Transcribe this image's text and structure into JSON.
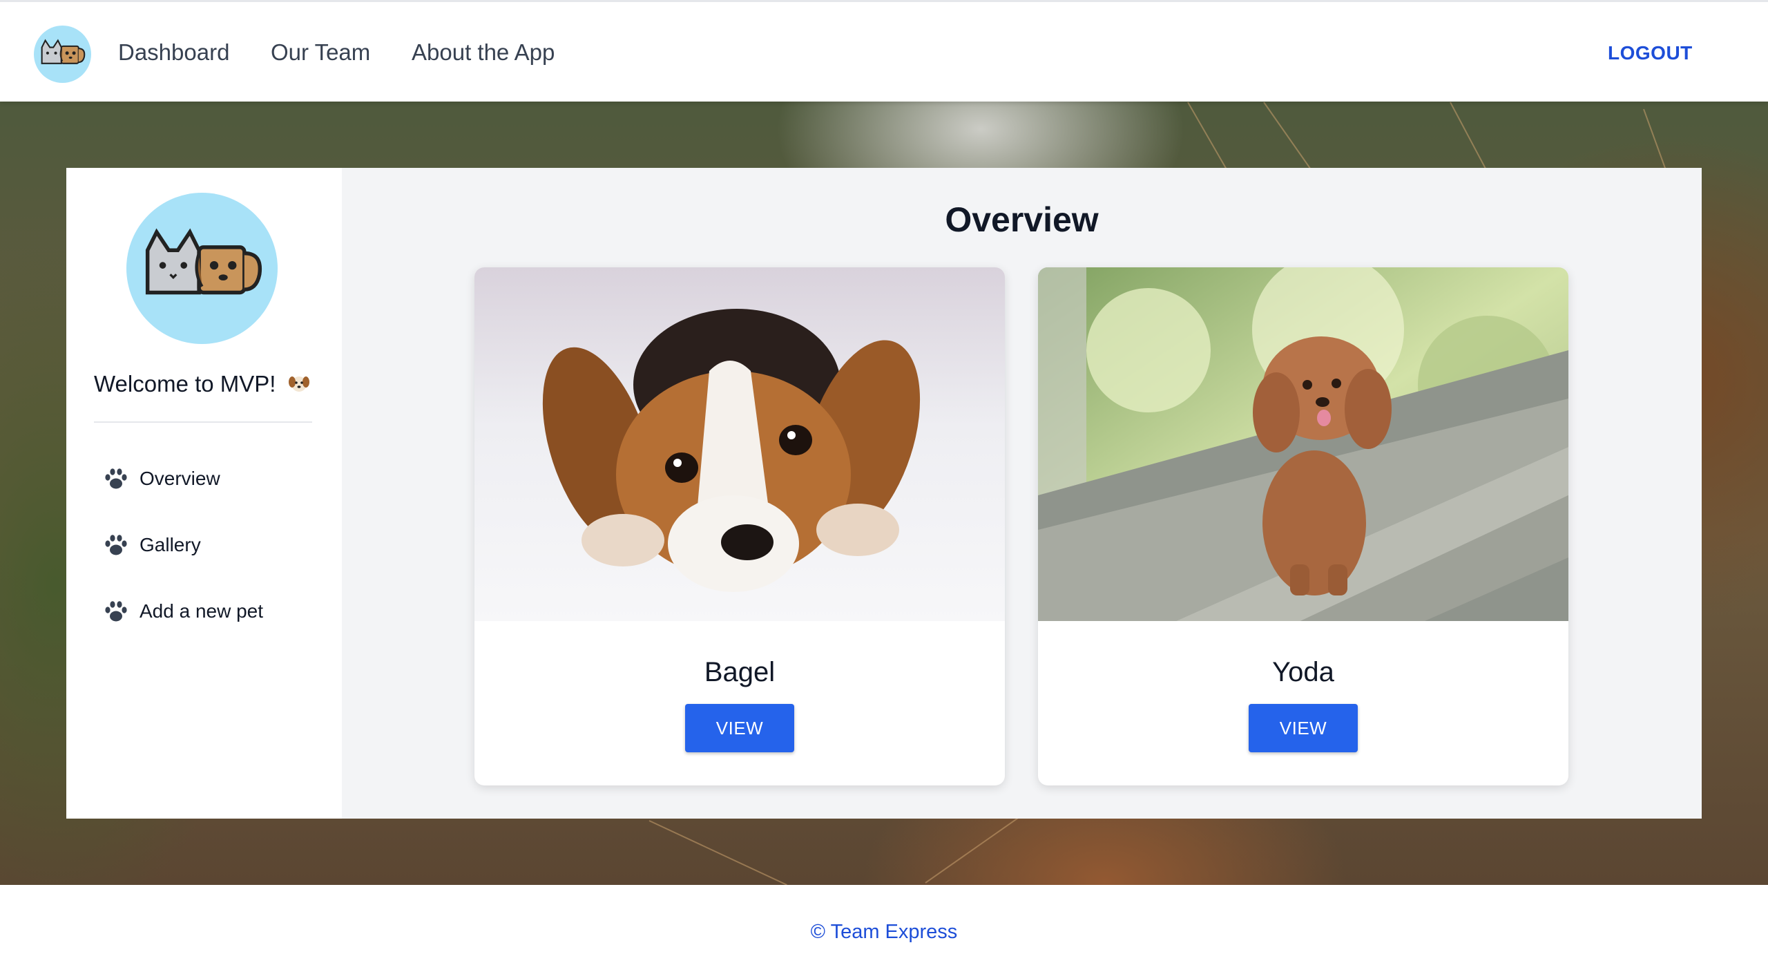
{
  "nav": {
    "logo_icon": "cat-dog-logo-icon",
    "links": [
      "Dashboard",
      "Our Team",
      "About the App"
    ],
    "logout_label": "LOGOUT"
  },
  "sidebar": {
    "logo_icon": "cat-dog-logo-icon",
    "welcome_text": "Welcome to MVP!",
    "welcome_emoji_icon": "dog-face-icon",
    "items": [
      {
        "label": "Overview",
        "icon": "paw-icon"
      },
      {
        "label": "Gallery",
        "icon": "paw-icon"
      },
      {
        "label": "Add a new pet",
        "icon": "paw-icon"
      }
    ]
  },
  "main": {
    "title": "Overview",
    "pets": [
      {
        "name": "Bagel",
        "button_label": "VIEW",
        "photo": "beagle-puppy-photo"
      },
      {
        "name": "Yoda",
        "button_label": "VIEW",
        "photo": "poodle-photo"
      }
    ]
  },
  "footer": {
    "text": "© Team Express"
  },
  "colors": {
    "accent": "#2563eb",
    "logo_bg": "#a8e2f8",
    "panel_bg": "#f3f4f6",
    "link": "#1d4ed8"
  }
}
